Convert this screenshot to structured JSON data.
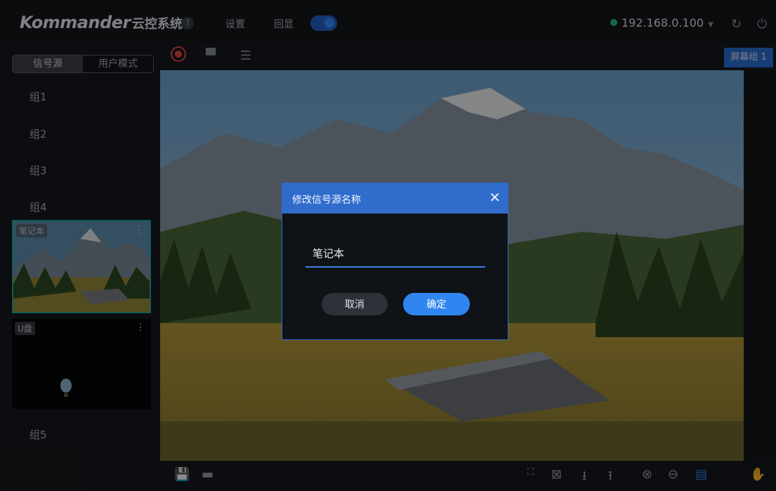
{
  "app": {
    "logo": "Kommander",
    "logo_sub": "云控系统",
    "help_icon": "?"
  },
  "topnav": {
    "settings": "设置",
    "echo": "回显",
    "echo_toggle_on": true
  },
  "connection": {
    "ip": "192.168.0.100",
    "status_color": "#27c07a"
  },
  "sidebar": {
    "tabs": [
      {
        "label": "信号源",
        "active": true
      },
      {
        "label": "用户模式",
        "active": false
      }
    ],
    "groups": [
      "组1",
      "组2",
      "组3",
      "组4",
      "组5"
    ],
    "sources": [
      {
        "label": "笔记本",
        "selected": true
      },
      {
        "label": "U盘",
        "selected": false
      }
    ]
  },
  "toolbar": {
    "screen_group": "屏幕组 1"
  },
  "dialog": {
    "title": "修改信号源名称",
    "input_value": "笔记本",
    "cancel": "取消",
    "confirm": "确定"
  },
  "colors": {
    "accent": "#2f6ccc",
    "record": "#e84747",
    "selection": "#1fa8a0"
  }
}
